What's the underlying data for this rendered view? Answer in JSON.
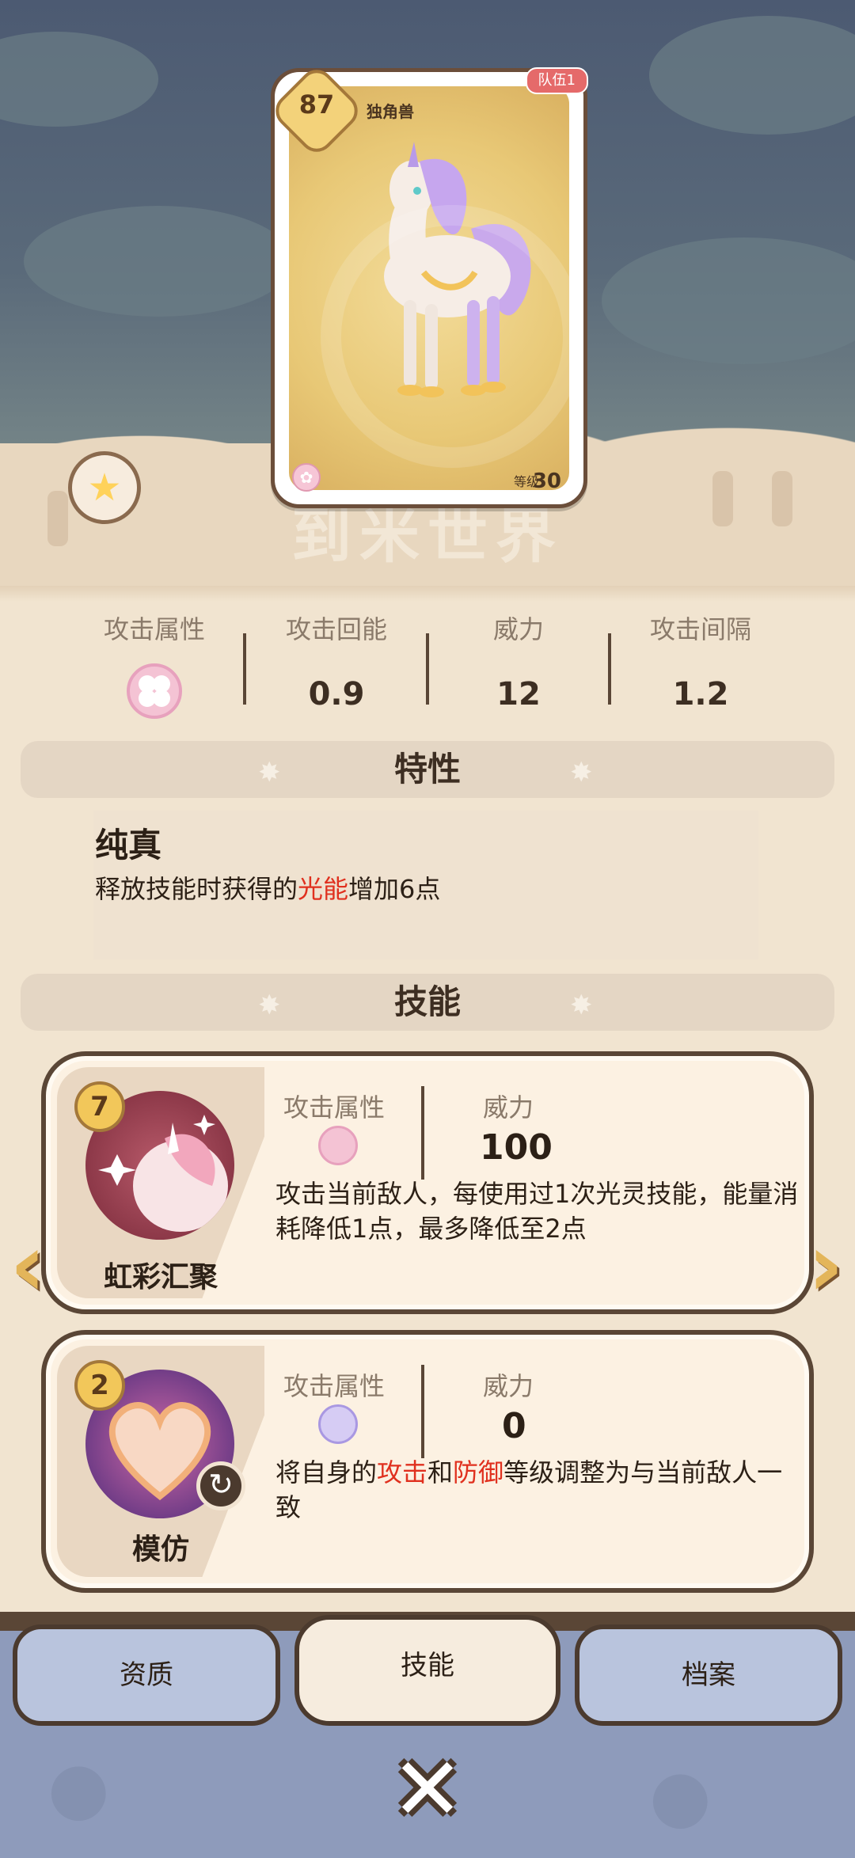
{
  "card": {
    "rank": "87",
    "team_badge": "队伍1",
    "name": "独角兽",
    "level_label": "等级",
    "level_value": "30"
  },
  "background_wordmark": "到米世界",
  "stats": [
    {
      "label": "攻击属性",
      "value": "",
      "icon": "light-flower-icon"
    },
    {
      "label": "攻击回能",
      "value": "0.9"
    },
    {
      "label": "威力",
      "value": "12"
    },
    {
      "label": "攻击间隔",
      "value": "1.2"
    }
  ],
  "trait_section": {
    "title": "特性",
    "name": "纯真",
    "desc_pre": "释放技能时获得的",
    "desc_highlight": "光能",
    "desc_post": "增加6点"
  },
  "skill_section": {
    "title": "技能"
  },
  "skills": [
    {
      "cost": "7",
      "name": "虹彩汇聚",
      "type_label": "攻击属性",
      "power_label": "威力",
      "power": "100",
      "type_icon": "light-flower-icon",
      "description": "攻击当前敌人，每使用过1次光灵技能，能量消耗降低1点，最多降低至2点"
    },
    {
      "cost": "2",
      "name": "模仿",
      "type_label": "攻击属性",
      "power_label": "威力",
      "power": "0",
      "type_icon": "purple-orb-icon",
      "desc_1": "将自身的",
      "desc_2": "攻击",
      "desc_3": "和",
      "desc_4": "防御",
      "desc_5": "等级调整为与当前敌人一致"
    }
  ],
  "tabs": [
    {
      "label": "资质",
      "active": false
    },
    {
      "label": "技能",
      "active": true
    },
    {
      "label": "档案",
      "active": false
    }
  ],
  "colors": {
    "highlight": "#e0301e",
    "panel_bg": "#f1e4d0",
    "nav_bg": "#8e9bbb",
    "border": "#5a4636"
  }
}
